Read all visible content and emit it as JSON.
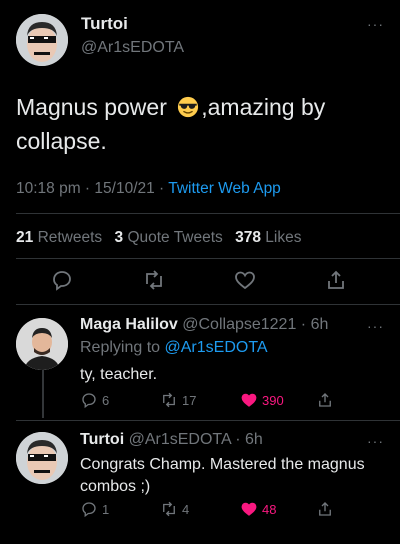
{
  "tweet": {
    "author_name": "Turtoi",
    "author_handle": "@Ar1sEDOTA",
    "text_part1": "Magnus power ",
    "text_emoji": "smiling-face-with-sunglasses",
    "text_part2": ",amazing by collapse.",
    "time": "10:18 pm · 15/10/21 · ",
    "source": "Twitter Web App",
    "stats": {
      "retweets_count": "21",
      "retweets_label": "Retweets",
      "quotes_count": "3",
      "quotes_label": "Quote Tweets",
      "likes_count": "378",
      "likes_label": "Likes"
    },
    "actions": [
      "reply-icon",
      "retweet-icon",
      "like-icon",
      "share-icon"
    ]
  },
  "replies": [
    {
      "name": "Maga Halilov",
      "handle_time": " @Collapse1221 · 6h",
      "replying_prefix": "Replying to ",
      "replying_handle": "@Ar1sEDOTA",
      "text": "ty, teacher.",
      "reply_count": "6",
      "retweet_count": "17",
      "like_count": "390",
      "liked": true
    },
    {
      "name": "Turtoi",
      "handle_time": " @Ar1sEDOTA · 6h",
      "text": "Congrats Champ. Mastered the magnus combos ;)",
      "reply_count": "1",
      "retweet_count": "4",
      "like_count": "48",
      "liked": true
    }
  ],
  "more_label": "···",
  "colors": {
    "accent": "#1d9bf0",
    "like": "#f91880",
    "muted": "#71767b",
    "background": "#000000"
  }
}
